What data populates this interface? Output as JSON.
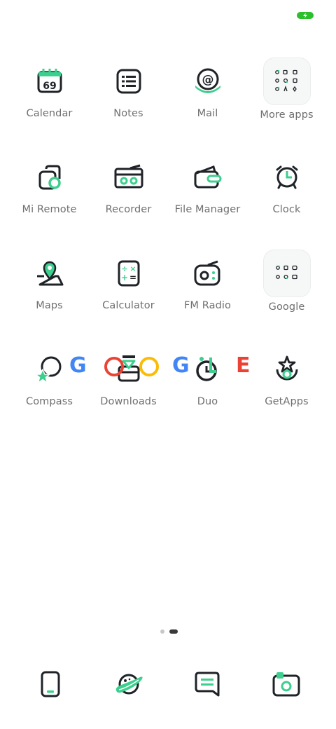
{
  "colors": {
    "accent": "#3ccf8e",
    "ink": "#1f2328",
    "label": "#6f6f6f",
    "battery": "#2bbf2b",
    "google_blue": "#4285f4",
    "google_red": "#ea4335",
    "google_yellow": "#fbbc05",
    "google_green": "#34a853"
  },
  "status_bar": {
    "battery_icon": "battery-charging-icon"
  },
  "apps": {
    "calendar": {
      "label": "Calendar",
      "icon": "calendar-icon",
      "date_text": "69"
    },
    "notes": {
      "label": "Notes",
      "icon": "notes-icon"
    },
    "mail": {
      "label": "Mail",
      "icon": "mail-icon"
    },
    "more_apps": {
      "label": "More apps",
      "icon": "folder-icon"
    },
    "mi_remote": {
      "label": "Mi Remote",
      "icon": "remote-icon"
    },
    "recorder": {
      "label": "Recorder",
      "icon": "recorder-icon"
    },
    "file_manager": {
      "label": "File Manager",
      "icon": "folder-file-icon"
    },
    "clock": {
      "label": "Clock",
      "icon": "alarm-clock-icon"
    },
    "maps": {
      "label": "Maps",
      "icon": "map-pin-icon"
    },
    "calculator": {
      "label": "Calculator",
      "icon": "calculator-icon"
    },
    "fm_radio": {
      "label": "FM Radio",
      "icon": "radio-icon"
    },
    "google": {
      "label": "Google",
      "icon": "folder-icon"
    },
    "compass": {
      "label": "Compass",
      "icon": "compass-icon"
    },
    "downloads": {
      "label": "Downloads",
      "icon": "download-icon"
    },
    "duo": {
      "label": "Duo",
      "icon": "duo-icon"
    },
    "getapps": {
      "label": "GetApps",
      "icon": "getapps-icon"
    }
  },
  "google_doodle": {
    "letters": [
      "G",
      "G",
      "L",
      "E"
    ]
  },
  "page_indicator": {
    "pages": 2,
    "current": 2
  },
  "dock": {
    "phone": {
      "icon": "phone-icon"
    },
    "browser": {
      "icon": "browser-planet-icon"
    },
    "messaging": {
      "icon": "messaging-icon"
    },
    "camera": {
      "icon": "camera-icon"
    }
  }
}
